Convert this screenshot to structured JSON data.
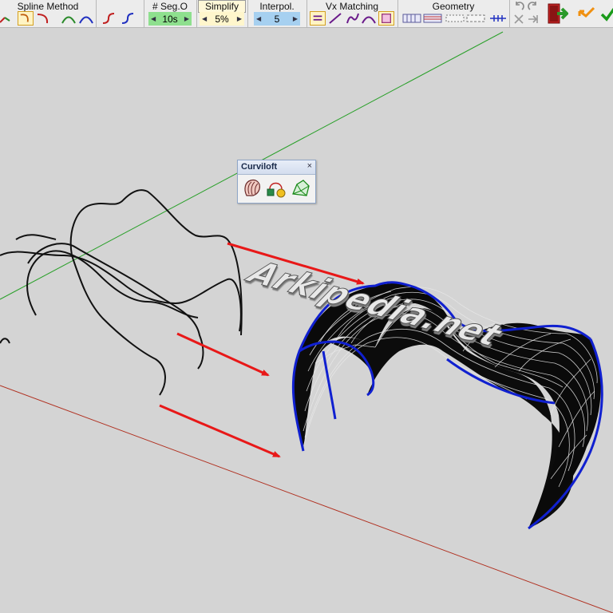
{
  "toolbar": {
    "spline_method": {
      "title": "Spline Method"
    },
    "seg": {
      "title": "# Seg.O",
      "value": "10s"
    },
    "simplify": {
      "title": "Simplify",
      "value": "5%"
    },
    "interpol": {
      "title": "Interpol.",
      "value": "5"
    },
    "vx_matching": {
      "title": "Vx Matching"
    },
    "geometry": {
      "title": "Geometry"
    }
  },
  "panel": {
    "title": "Curviloft",
    "close": "×"
  },
  "watermark": {
    "text": "Arkipedia.net"
  },
  "colors": {
    "axis_green": "#2aa02a",
    "axis_red": "#b03020",
    "edge_blue": "#1020d0",
    "arrow_red": "#e81818",
    "spinner_green": "#8ee08e",
    "spinner_blue": "#a6d0f0",
    "spinner_yellow": "#fff6cc"
  },
  "icons": [
    "spline-method-icon",
    "seg-count-icon",
    "simplify-icon",
    "interpolation-icon",
    "vx-matching-icon",
    "geometry-icon",
    "undo-icon",
    "redo-icon",
    "exit-icon",
    "back-icon",
    "validate-icon",
    "curviloft-loft-icon",
    "curviloft-skin-icon",
    "curviloft-contour-icon"
  ]
}
